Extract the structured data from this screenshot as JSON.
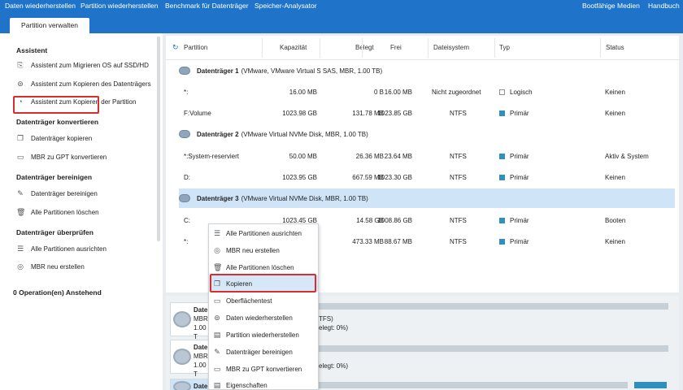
{
  "menubar": {
    "items": [
      "Daten wiederherstellen",
      "Partition wiederherstellen",
      "Benchmark für Datenträger",
      "Speicher-Analysator"
    ],
    "right": [
      "Bootfähige Medien",
      "Handbuch"
    ]
  },
  "tab": "Partition verwalten",
  "sidebar": {
    "sections": [
      {
        "title": "Assistent",
        "items": [
          "Assistent zum Migrieren OS auf SSD/HD",
          "Assistent zum Kopieren des Datenträgers",
          "Assistent zum Kopieren der Partition"
        ]
      },
      {
        "title": "Datenträger konvertieren",
        "items": [
          "Datenträger kopieren",
          "MBR zu GPT konvertieren"
        ]
      },
      {
        "title": "Datenträger bereinigen",
        "items": [
          "Datenträger bereinigen",
          "Alle Partitionen löschen"
        ]
      },
      {
        "title": "Datenträger überprüfen",
        "items": [
          "Alle Partitionen ausrichten",
          "MBR neu erstellen"
        ]
      }
    ],
    "pending": "0 Operation(en) Anstehend"
  },
  "table": {
    "columns": [
      "Partition",
      "Kapazität",
      "Belegt",
      "Frei",
      "Dateisystem",
      "Typ",
      "Status"
    ],
    "disks": [
      {
        "name": "Datenträger 1",
        "desc": "(VMware, VMware Virtual S SAS, MBR, 1.00 TB)",
        "rows": [
          {
            "partition": "*:",
            "capacity": "16.00 MB",
            "used": "0 B",
            "free": "16.00 MB",
            "fs": "Nicht zugeordnet",
            "type": "Logisch",
            "status": "Keinen"
          },
          {
            "partition": "F:Volume",
            "capacity": "1023.98 GB",
            "used": "131.78 MB",
            "free": "1023.85 GB",
            "fs": "NTFS",
            "type": "Primär",
            "status": "Keinen"
          }
        ]
      },
      {
        "name": "Datenträger 2",
        "desc": "(VMware Virtual NVMe Disk, MBR, 1.00 TB)",
        "rows": [
          {
            "partition": "*:System-reserviert",
            "capacity": "50.00 MB",
            "used": "26.36 MB",
            "free": "23.64 MB",
            "fs": "NTFS",
            "type": "Primär",
            "status": "Aktiv & System"
          },
          {
            "partition": "D:",
            "capacity": "1023.95 GB",
            "used": "667.59 MB",
            "free": "1023.30 GB",
            "fs": "NTFS",
            "type": "Primär",
            "status": "Keinen"
          }
        ]
      },
      {
        "name": "Datenträger 3",
        "desc": "(VMware Virtual NVMe Disk, MBR, 1.00 TB)",
        "rows": [
          {
            "partition": "C:",
            "capacity": "1023.45 GB",
            "used": "14.58 GB",
            "free": "1008.86 GB",
            "fs": "NTFS",
            "type": "Primär",
            "status": "Booten"
          },
          {
            "partition": "*:",
            "capacity": "",
            "used": "473.33 MB",
            "free": "88.67 MB",
            "fs": "NTFS",
            "type": "Primär",
            "status": "Keinen"
          }
        ]
      }
    ]
  },
  "lower": {
    "cards": [
      {
        "title": "Date",
        "line1": "MBR",
        "line2": "1.00 T"
      },
      {
        "title": "Date",
        "line1": "MBR",
        "line2": "1.00 T"
      },
      {
        "title": "Date"
      }
    ],
    "texts": [
      "TFS)",
      "elegt: 0%)",
      "elegt: 0%)"
    ]
  },
  "context_menu": {
    "items": [
      "Alle Partitionen ausrichten",
      "MBR neu erstellen",
      "Alle Partitionen löschen",
      "Kopieren",
      "Oberflächentest",
      "Daten wiederherstellen",
      "Partition wiederherstellen",
      "Datenträger bereinigen",
      "MBR zu GPT konvertieren",
      "Eigenschaften"
    ]
  },
  "colors": {
    "accent": "#1f74c9",
    "highlight": "#d72f2f",
    "selected_row": "#cfe4f7",
    "logical_square": "#9aa3ad",
    "primary_square": "#2f8fbf"
  }
}
